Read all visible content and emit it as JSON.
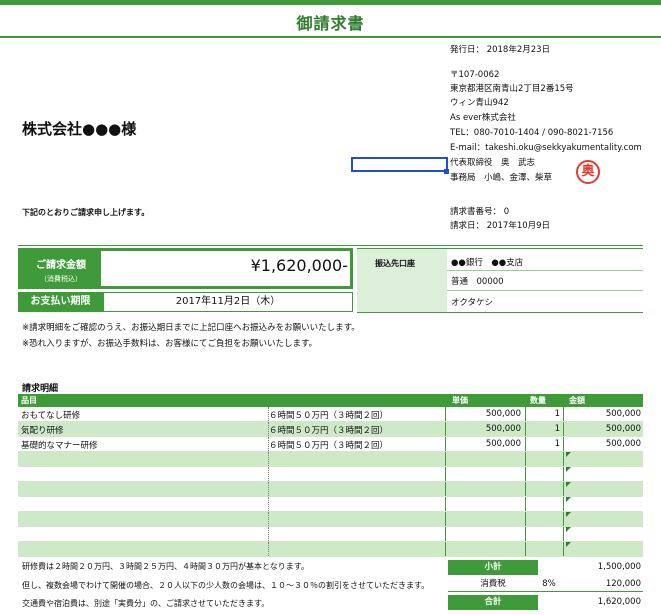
{
  "header": {
    "title": "御請求書",
    "issue_date": "発行日： 2018年2月23日"
  },
  "client": "株式会社●●●様",
  "sender": {
    "postal": "〒107-0062",
    "address1": "東京都港区南青山2丁目2番15号",
    "address2": "ウィン青山942",
    "company": "As ever株式会社",
    "tel": "TEL：080-7010-1404 / 090-8021-7156",
    "email": "E-mail：takeshi.oku@sekkyakumentality.com",
    "rep": "代表取締役　奥　武志",
    "office": "事務局　小嶋、金澤、柴草",
    "seal": "奥"
  },
  "intro": "下記のとおりご請求申し上げます。",
  "invoice": {
    "number": "請求書番号： 0",
    "date": "請求日： 2017年10月9日"
  },
  "amount": {
    "label": "ご請求金額",
    "sublabel": "（消費税込）",
    "value": "¥1,620,000-",
    "due_label": "お支払い期限",
    "due_value": "2017年11月2日（木）"
  },
  "bank": {
    "label": "振込先口座",
    "line1": "●●銀行　●●支店",
    "line2": "普通　00000",
    "line3": "オクタケシ"
  },
  "remarks": [
    "※請求明細をご確認のうえ、お振込期日までに上記口座へお振込みをお願いいたします。",
    "※恐れ入りますが、お振込手数料は、お客様にてご負担をお願いいたします。"
  ],
  "details": {
    "title": "請求明細",
    "headers": {
      "item": "品目",
      "price": "単価",
      "qty": "数量",
      "amount": "金額"
    },
    "rows": [
      {
        "item": "おもてなし研修",
        "note": "６時間５０万円（３時間２回）",
        "price": "500,000",
        "qty": "1",
        "amount": "500,000"
      },
      {
        "item": "気配り研修",
        "note": "６時間５０万円（３時間２回）",
        "price": "500,000",
        "qty": "1",
        "amount": "500,000"
      },
      {
        "item": "基礎的なマナー研修",
        "note": "６時間５０万円（３時間２回）",
        "price": "500,000",
        "qty": "1",
        "amount": "500,000"
      }
    ]
  },
  "footer_notes": [
    "研修費は２時間２０万円、３時間２５万円、４時間３０万円が基本となります。",
    "但し、複数会場でわけて開催の場合、２０人以下の少人数の会場は、１０～３０％の割引をさせていただきます。",
    "交通費や宿泊費は、別途「実費分」の、ご請求させていただきます。"
  ],
  "totals": {
    "subtotal_label": "小計",
    "subtotal": "1,500,000",
    "tax_label": "消費税",
    "tax_rate": "8%",
    "tax": "120,000",
    "total_label": "合計",
    "total": "1,620,000"
  }
}
